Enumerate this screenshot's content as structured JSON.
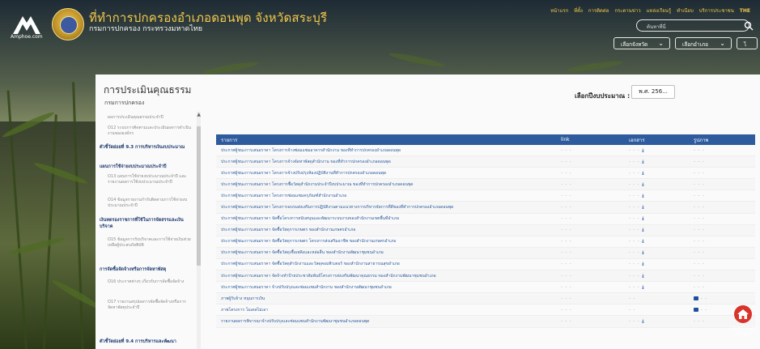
{
  "header": {
    "logo_text": "Amphoe.com",
    "title": "ที่ทำการปกครองอำเภอดอนพุด จังหวัดสระบุรี",
    "subtitle": "กรมการปกครอง กระทรวงมหาดไทย",
    "top_links": [
      "หน้าแรก",
      "ที่ตั้ง",
      "การติดต่อ",
      "กระดานข่าว",
      "แหล่งเรียนรู้",
      "ทำเนียบ",
      "บริการประชาชน",
      "THE"
    ],
    "search_placeholder": "ค้นหาที่นี่",
    "province_select": "เลือกจังหวัด",
    "district_select": "เลือกอำเภอ",
    "extra_button": "ไ"
  },
  "card": {
    "title": "การประเมินคุณธรรม",
    "subtitle": "กรมการปกครอง",
    "year_label": "เลือกปีงบประมาณ :",
    "year_value": "พ.ศ. 256..."
  },
  "sidebar": {
    "items": [
      {
        "type": "item",
        "text": "ผลการประเมินคุณธรรมประจำปี"
      },
      {
        "type": "item",
        "text": "O12 ระบบการติดตามและประเมินผลการดำเนินงานขององค์กร"
      },
      {
        "type": "head",
        "text": "ตัวชี้วัดย่อยที่ 9.3 การบริหารเงินงบประมาณ"
      },
      {
        "type": "head",
        "text": "แผนการใช้จ่ายงบประมาณประจำปี"
      },
      {
        "type": "item",
        "text": "O13 แผนการใช้จ่ายงบประมาณประจำปี และรายงานผลการใช้งบประมาณประจำปี"
      },
      {
        "type": "item",
        "text": "O14 ข้อมูลรายงานกำกับติดตามการใช้จ่ายงบประมาณประจำปี"
      },
      {
        "type": "head",
        "text": "เงินทดรองราชการที่ใช้ในการจัดสรรและเงินบริจาค"
      },
      {
        "type": "item",
        "text": "O15 ข้อมูลการรับบริจาคและการใช้จ่ายเงินช่วยเหลือผู้ประสบภัยพิบัติ"
      },
      {
        "type": "head",
        "text": "การจัดซื้อจัดจ้างหรือการจัดหาพัสดุ"
      },
      {
        "type": "item",
        "text": "O16 ประกาศต่างๆ เกี่ยวกับการจัดซื้อจัดจ้าง"
      },
      {
        "type": "item",
        "text": "O17 รายงานสรุปผลการจัดซื้อจัดจ้างหรือการจัดหาพัสดุประจำปี"
      },
      {
        "type": "head",
        "text": "ตัวชี้วัดย่อยที่ 9.4 การบริหารและพัฒนา"
      }
    ]
  },
  "table": {
    "headers": [
      "รายการ",
      "link",
      "เอกสาร",
      "รูปภาพ"
    ],
    "rows": [
      {
        "name": "ประกาศผู้ชนะการเสนอราคา โครงการจ้างซ่อมแซมอาคารสำนักงาน ของที่ทำการปกครองอำเภอดอนพุด",
        "link": "- - -",
        "doc": "dl",
        "img": "- - -"
      },
      {
        "name": "ประกาศผู้ชนะการเสนอราคา โครงการจ้างจัดหาพัสดุสำนักงาน ของที่ทำการปกครองอำเภอดอนพุด",
        "link": "- - -",
        "doc": "dl",
        "img": "- - -"
      },
      {
        "name": "ประกาศผู้ชนะการเสนอราคา โครงการจ้างปรับปรุงห้องปฏิบัติงานที่ทำการปกครองอำเภอดอนพุด",
        "link": "- - -",
        "doc": "dl",
        "img": "- - -"
      },
      {
        "name": "ประกาศผู้ชนะการเสนอราคา โครงการซื้อวัสดุสำนักงานประจำปีงบประมาณ ของที่ทำการปกครองอำเภอดอนพุด",
        "link": "- - -",
        "doc": "dl",
        "img": "- - -"
      },
      {
        "name": "ประกาศผู้ชนะการเสนอราคา โครงการซ่อมแซมครุภัณฑ์สำนักงานอำเภอ",
        "link": "- - -",
        "doc": "dl",
        "img": "- - -"
      },
      {
        "name": "ประกาศผู้ชนะการเสนอราคา โครงการอบรมส่งเสริมการปฏิบัติงานตามแนวทางการบริหารจัดการที่ดีของที่ทำการปกครองอำเภอดอนพุด",
        "link": "- - -",
        "doc": "dl",
        "img": "- - -"
      },
      {
        "name": "ประกาศผู้ชนะการเสนอราคา จัดซื้อโครงการสนับสนุนและพัฒนาระบบงานของสำนักงานเขตพื้นที่อำเภอ",
        "link": "- - -",
        "doc": "dl",
        "img": "- - -"
      },
      {
        "name": "ประกาศผู้ชนะการเสนอราคา จัดซื้อวัสดุการเกษตร ของสำนักงานเกษตรอำเภอ",
        "link": "- - -",
        "doc": "dl",
        "img": "- - -"
      },
      {
        "name": "ประกาศผู้ชนะการเสนอราคา จัดซื้อวัสดุการเกษตร โครงการส่งเสริมอาชีพ ของสำนักงานเกษตรอำเภอ",
        "link": "- - -",
        "doc": "dl",
        "img": "- - -"
      },
      {
        "name": "ประกาศผู้ชนะการเสนอราคา จัดซื้อวัสดุเชื้อเพลิงและหล่อลื่น ของสำนักงานพัฒนาชุมชนอำเภอ",
        "link": "- - -",
        "doc": "dl",
        "img": "- - -"
      },
      {
        "name": "ประกาศผู้ชนะการเสนอราคา จัดซื้อวัสดุสำนักงานและวัสดุคอมพิวเตอร์ ของสำนักงานสาธารณสุขอำเภอ",
        "link": "- - -",
        "doc": "dl",
        "img": "- - -"
      },
      {
        "name": "ประกาศผู้ชนะการเสนอราคา จัดจ้างทำป้ายประชาสัมพันธ์โครงการส่งเสริมพัฒนาคุณธรรม ของสำนักงานพัฒนาชุมชนอำเภอ",
        "link": "- - -",
        "doc": "dl",
        "img": "- - -"
      },
      {
        "name": "ประกาศผู้ชนะการเสนอราคา จ้างปรับปรุงและซ่อมแซมสำนักงาน ของสำนักงานพัฒนาชุมชนอำเภอ",
        "link": "- - -",
        "doc": "dl",
        "img": "- - -"
      },
      {
        "name": "ภาพผู้รับจ้าง หนุนการเงิน",
        "link": "- - -",
        "doc": "- -",
        "img": "pc"
      },
      {
        "name": "ภาพโครงการ โมเดลไม่เอา",
        "link": "- - -",
        "doc": "- -",
        "img": "pc"
      },
      {
        "name": "รายงานผลการพิจารณาจ้างปรับปรุงและซ่อมแซมสำนักงานพัฒนาชุมชนอำเภอดอนพุด",
        "link": "- - -",
        "doc": "dl",
        "img": "- - -"
      }
    ]
  },
  "home": {
    "label": "กลับหน้าหลัก (อำเภอ)"
  },
  "colors": {
    "accent": "#2d5b9e",
    "title_gold": "#f2c94c",
    "home_red": "#d9342b"
  }
}
